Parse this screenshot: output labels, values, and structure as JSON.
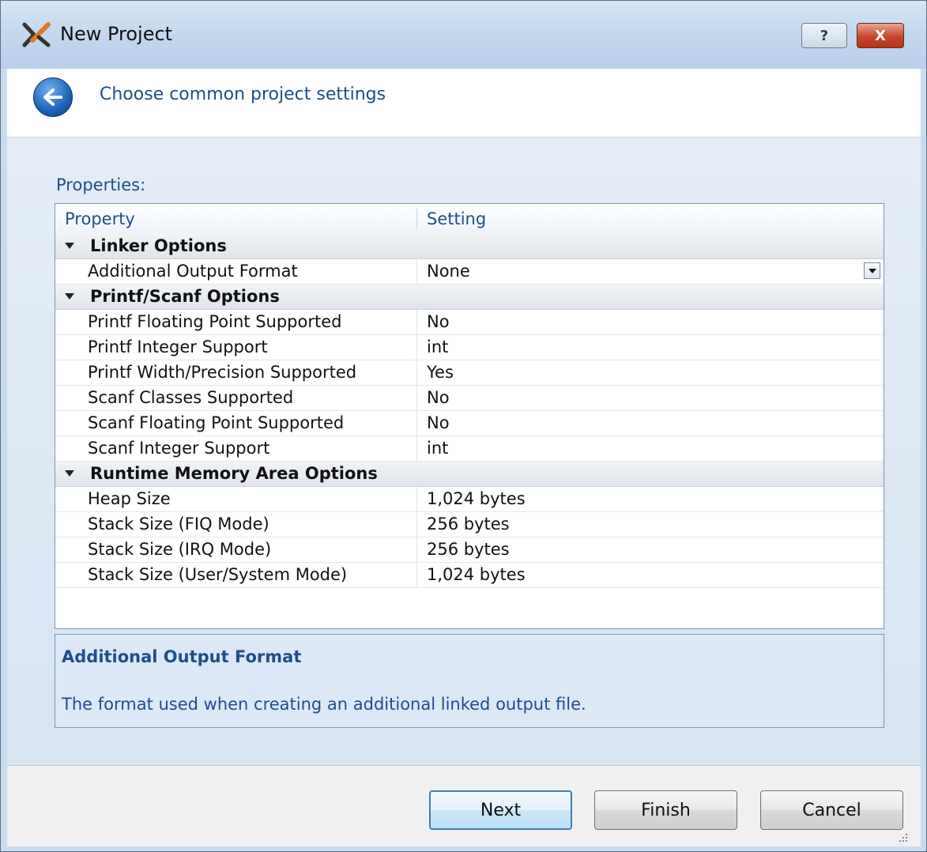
{
  "window": {
    "title": "New Project"
  },
  "title_buttons": {
    "help": "?",
    "close": "X"
  },
  "header": {
    "text": "Choose common project settings"
  },
  "properties": {
    "label": "Properties:",
    "columns": {
      "property": "Property",
      "setting": "Setting"
    },
    "rows": [
      {
        "type": "category",
        "label": "Linker Options"
      },
      {
        "type": "property",
        "name": "Additional Output Format",
        "value": "None",
        "dropdown": true
      },
      {
        "type": "category",
        "label": "Printf/Scanf Options"
      },
      {
        "type": "property",
        "name": "Printf Floating Point Supported",
        "value": "No"
      },
      {
        "type": "property",
        "name": "Printf Integer Support",
        "value": "int"
      },
      {
        "type": "property",
        "name": "Printf Width/Precision Supported",
        "value": "Yes"
      },
      {
        "type": "property",
        "name": "Scanf Classes Supported",
        "value": "No"
      },
      {
        "type": "property",
        "name": "Scanf Floating Point Supported",
        "value": "No"
      },
      {
        "type": "property",
        "name": "Scanf Integer Support",
        "value": "int"
      },
      {
        "type": "category",
        "label": "Runtime Memory Area Options"
      },
      {
        "type": "property",
        "name": "Heap Size",
        "value": "1,024 bytes"
      },
      {
        "type": "property",
        "name": "Stack Size (FIQ Mode)",
        "value": "256 bytes"
      },
      {
        "type": "property",
        "name": "Stack Size (IRQ Mode)",
        "value": "256 bytes"
      },
      {
        "type": "property",
        "name": "Stack Size (User/System Mode)",
        "value": "1,024 bytes"
      }
    ]
  },
  "description": {
    "title": "Additional Output Format",
    "text": "The format used when creating an additional linked output file."
  },
  "buttons": {
    "next": "Next",
    "finish": "Finish",
    "cancel": "Cancel"
  }
}
